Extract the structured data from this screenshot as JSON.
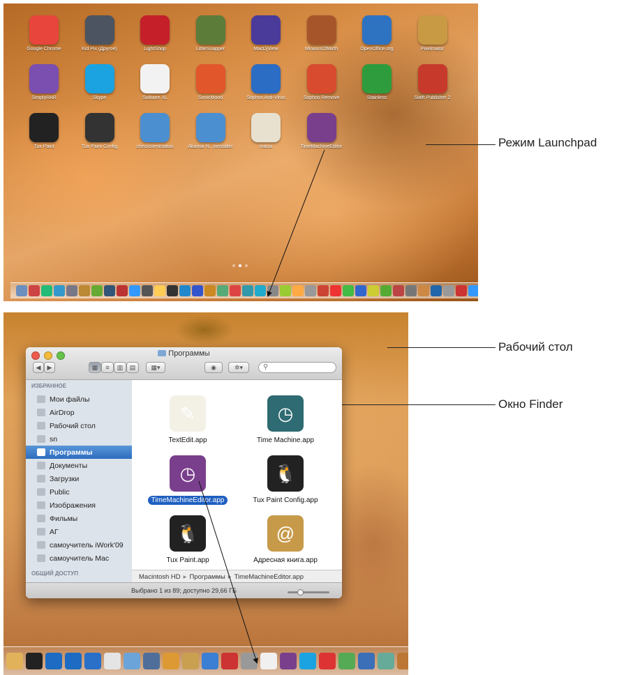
{
  "callouts": {
    "launchpad": "Режим Launchpad",
    "desktop": "Рабочий стол",
    "finder_window": "Окно Finder"
  },
  "launchpad": {
    "apps": [
      {
        "label": "Google Chrome",
        "color": "#e8453c"
      },
      {
        "label": "Kid Pix (Другое)",
        "color": "#4b5460"
      },
      {
        "label": "LightShop",
        "color": "#c51f2a"
      },
      {
        "label": "LittleSnapper",
        "color": "#5c7c3a"
      },
      {
        "label": "MacDjView",
        "color": "#4a3b9a"
      },
      {
        "label": "MinionsOfMirth",
        "color": "#a6552a"
      },
      {
        "label": "OpenOffice.org",
        "color": "#2e73c2"
      },
      {
        "label": "Pixelmator",
        "color": "#c99a44"
      },
      {
        "label": "SimplyRAR",
        "color": "#7b4fb0"
      },
      {
        "label": "Skype",
        "color": "#1aa3e0"
      },
      {
        "label": "Solitaire XL",
        "color": "#f2f2f2"
      },
      {
        "label": "SonicMood",
        "color": "#e2562b"
      },
      {
        "label": "Sophos Anti-Virus",
        "color": "#2b6cc4"
      },
      {
        "label": "Sophos Remove",
        "color": "#d94b2f"
      },
      {
        "label": "Stainless",
        "color": "#2e9c3c"
      },
      {
        "label": "Swift Publisher 2",
        "color": "#c73a2b"
      },
      {
        "label": "Tux Paint",
        "color": "#222222"
      },
      {
        "label": "Tux Paint Config",
        "color": "#333333"
      },
      {
        "label": "checkclientstatus",
        "color": "#4c8fd1"
      },
      {
        "label": "Akamai N...ninstaller",
        "color": "#4c8fd1"
      },
      {
        "label": "macui",
        "color": "#e8e1cf"
      },
      {
        "label": "TimeMachineEditor",
        "color": "#7a3f8c"
      }
    ],
    "page_count": 3,
    "active_page": 2
  },
  "finder": {
    "window_title": "Программы",
    "search_placeholder": "",
    "sidebar": {
      "favorites_header": "ИЗБРАННОЕ",
      "items": [
        {
          "label": "Мои файлы",
          "icon": "documents-icon"
        },
        {
          "label": "AirDrop",
          "icon": "airdrop-icon"
        },
        {
          "label": "Рабочий стол",
          "icon": "desktop-icon"
        },
        {
          "label": "sn",
          "icon": "home-icon"
        },
        {
          "label": "Программы",
          "icon": "applications-icon",
          "selected": true
        },
        {
          "label": "Документы",
          "icon": "documents-folder-icon"
        },
        {
          "label": "Загрузки",
          "icon": "downloads-icon"
        },
        {
          "label": "Public",
          "icon": "folder-icon"
        },
        {
          "label": "Изображения",
          "icon": "camera-icon"
        },
        {
          "label": "Фильмы",
          "icon": "film-icon"
        },
        {
          "label": "АГ",
          "icon": "folder-icon"
        },
        {
          "label": "самоучитель iWork'09",
          "icon": "folder-icon"
        },
        {
          "label": "самоучитель Mac",
          "icon": "folder-icon"
        }
      ],
      "shared_header": "ОБЩИЙ ДОСТУП"
    },
    "files": [
      {
        "label": "TextEdit.app",
        "icon": "textedit-icon",
        "color": "#f3f0e6"
      },
      {
        "label": "Time Machine.app",
        "icon": "time-machine-icon",
        "color": "#2e6b73"
      },
      {
        "label": "TimeMachineEditor.app",
        "icon": "timemachineeditor-icon",
        "color": "#7a3f8c",
        "selected": true
      },
      {
        "label": "Tux Paint Config.app",
        "icon": "tux-icon",
        "color": "#222222"
      },
      {
        "label": "Tux Paint.app",
        "icon": "tux-icon",
        "color": "#222222"
      },
      {
        "label": "Адресная книга.app",
        "icon": "address-book-icon",
        "color": "#c79a4a"
      }
    ],
    "path": [
      "Macintosh HD",
      "Программы",
      "TimeMachineEditor.app"
    ],
    "status": "Выбрано 1 из 89; доступно 29,66 ГБ"
  },
  "dock": {
    "launchpad_colors": [
      "#6b8fbf",
      "#c44",
      "#2b7",
      "#39c",
      "#778",
      "#b83",
      "#6a3",
      "#357",
      "#b33",
      "#39f",
      "#555",
      "#fc5",
      "#333",
      "#28c",
      "#35c",
      "#c82",
      "#5a7",
      "#d44",
      "#39a",
      "#2ac",
      "#888",
      "#9c3",
      "#fa4",
      "#999",
      "#c43",
      "#e33",
      "#4b4",
      "#36c",
      "#cc3",
      "#5a3",
      "#b44",
      "#777",
      "#c84",
      "#26a",
      "#999",
      "#c33",
      "#39f",
      "#888",
      "#ccc",
      "#39c",
      "#aaa",
      "#777"
    ],
    "desktop_colors": [
      "#e2b25a",
      "#222",
      "#1d6bc2",
      "#1d6bc2",
      "#2a6fc8",
      "#e4e4e4",
      "#6aa4d8",
      "#4f6f9a",
      "#dd9933",
      "#c9a050",
      "#3a7fd4",
      "#c33",
      "#999",
      "#f0f0f0",
      "#7a3f8c",
      "#1aa3e0",
      "#d33",
      "#5a5",
      "#3b6fb7",
      "#6a9",
      "#b73",
      "#cc3",
      "#d55"
    ]
  }
}
